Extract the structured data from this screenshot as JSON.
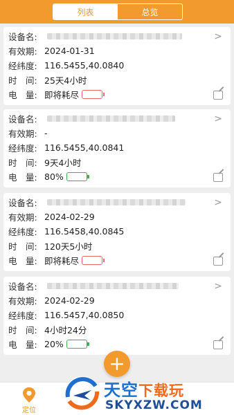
{
  "header": {
    "tabs": [
      {
        "label": "列表",
        "active": true
      },
      {
        "label": "总览",
        "active": false
      }
    ],
    "accent": "#f29a2e"
  },
  "labels": {
    "name": "设备名:",
    "expiry": "有效期:",
    "coords": "经纬度:",
    "time": "时　间:",
    "battery": "电　量:"
  },
  "devices": [
    {
      "expiry": "2024-01-31",
      "coords": "116.5455,40.0840",
      "time": "25天4小时",
      "battery_text": "即将耗尽",
      "battery_level": 0.12
    },
    {
      "expiry": "-",
      "coords": "116.5455,40.0841",
      "time": "9天4小时",
      "battery_text": "80%",
      "battery_level": 0.8
    },
    {
      "expiry": "2024-02-29",
      "coords": "116.5458,40.0845",
      "time": "120天5小时",
      "battery_text": "即将耗尽",
      "battery_level": 0.12
    },
    {
      "expiry": "2024-02-29",
      "coords": "116.5457,40.0850",
      "time": "4小时24分",
      "battery_text": "20%",
      "battery_level": 0.2
    }
  ],
  "fab": {
    "label": "+"
  },
  "bottom_nav": {
    "label": "定位",
    "icon": "location-pin-icon"
  },
  "watermark": {
    "title": "天空",
    "subtitle": "下载玩",
    "url": "SKYXZW.COM"
  }
}
